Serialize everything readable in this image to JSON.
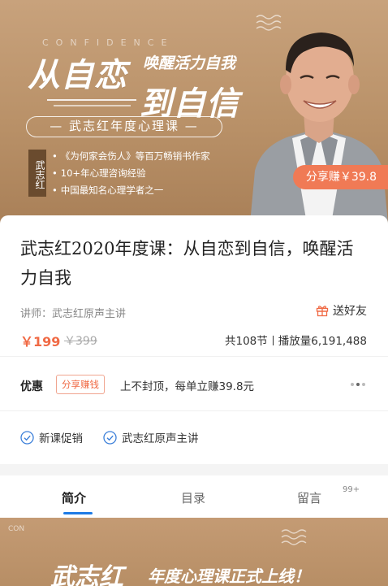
{
  "banner": {
    "confidence_word": "CONFIDENCE",
    "title_line1": "从自恋",
    "title_line2": "到自信",
    "subtitle": "唤醒活力自我",
    "course_pill": "— 武志红年度心理课 —",
    "name_tag": "武志红",
    "bullets": [
      "《为何家会伤人》等百万畅销书作家",
      "10+年心理咨询经验",
      "中国最知名心理学者之一"
    ],
    "share_badge": "分享赚￥39.8"
  },
  "course": {
    "title": "武志红2020年度课：从自恋到自信，唤醒活力自我",
    "lecturer": "讲师：武志红原声主讲",
    "gift_label": "送好友",
    "price": "￥199",
    "original_price": "￥399",
    "sections": "共108节",
    "plays": "播放量6,191,488"
  },
  "promo": {
    "label": "优惠",
    "tag": "分享赚钱",
    "text": "上不封顶，每单立赚39.8元"
  },
  "features": [
    "新课促销",
    "武志红原声主讲"
  ],
  "tabs": {
    "items": [
      {
        "label": "简介"
      },
      {
        "label": "目录"
      },
      {
        "label": "留言"
      }
    ],
    "comment_badge": "99+"
  },
  "bottom_banner": {
    "vertical_text": "CON",
    "title": "武志红",
    "subtitle": "年度心理课正式上线！"
  },
  "colors": {
    "accent": "#f06a45",
    "tab_active": "#1e7be6",
    "banner_gold": "#b99168"
  }
}
